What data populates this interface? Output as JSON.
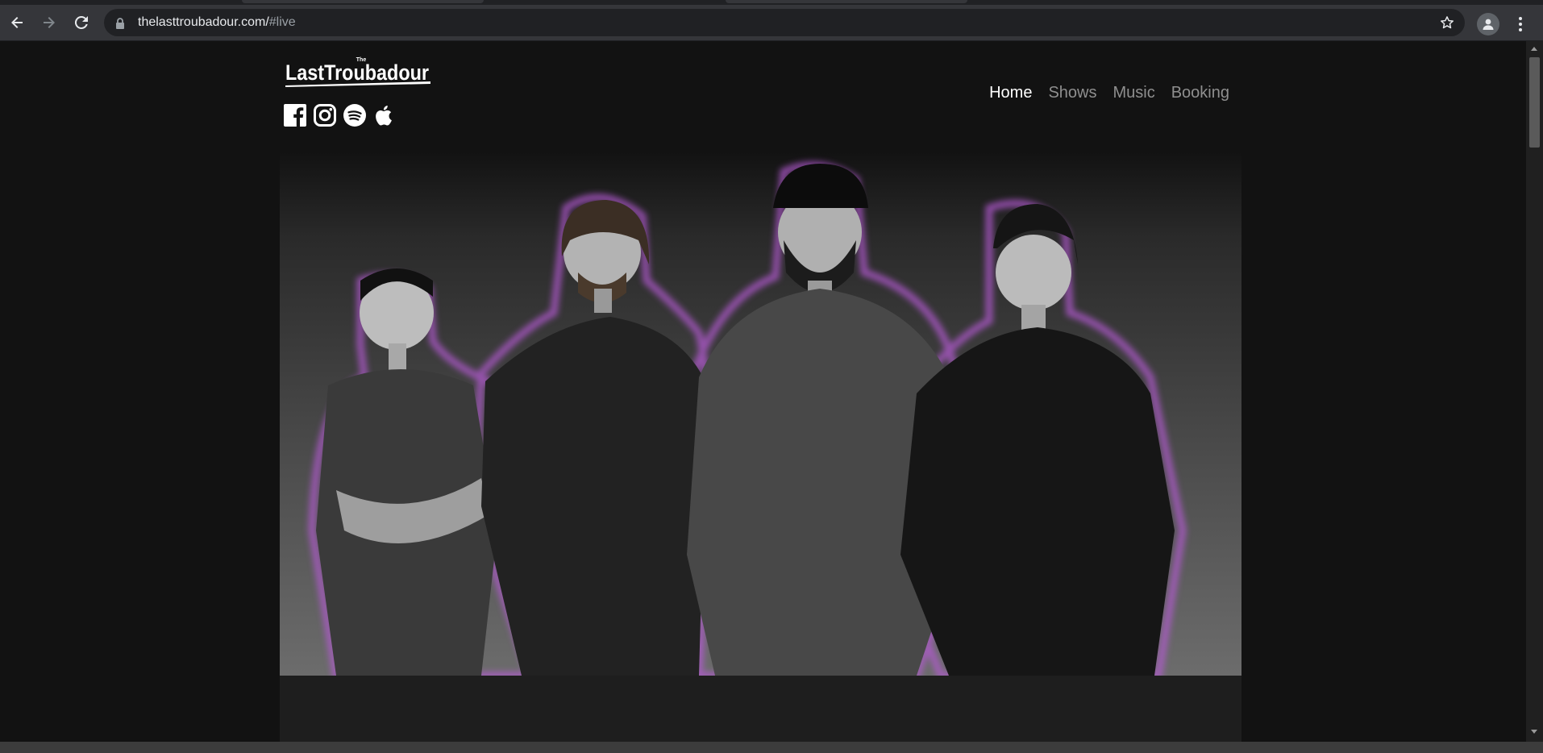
{
  "browser": {
    "url_host": "thelasttroubadour.com/",
    "url_fragment": "#live",
    "icons": [
      "back-arrow-icon",
      "forward-arrow-icon",
      "reload-icon",
      "lock-icon",
      "star-icon",
      "profile-icon",
      "more-menu-icon"
    ]
  },
  "site": {
    "logo": {
      "small": "The",
      "main": "LastTroubadour"
    },
    "socials": [
      "facebook-icon",
      "instagram-icon",
      "spotify-icon",
      "apple-icon"
    ],
    "nav": [
      {
        "label": "Home",
        "active": true
      },
      {
        "label": "Shows",
        "active": false
      },
      {
        "label": "Music",
        "active": false
      },
      {
        "label": "Booking",
        "active": false
      }
    ]
  },
  "colors": {
    "page_bg": "#121212",
    "nav_active": "#ffffff",
    "nav_inactive": "#8f8f8f",
    "hero_glow": "#b45ad2"
  }
}
